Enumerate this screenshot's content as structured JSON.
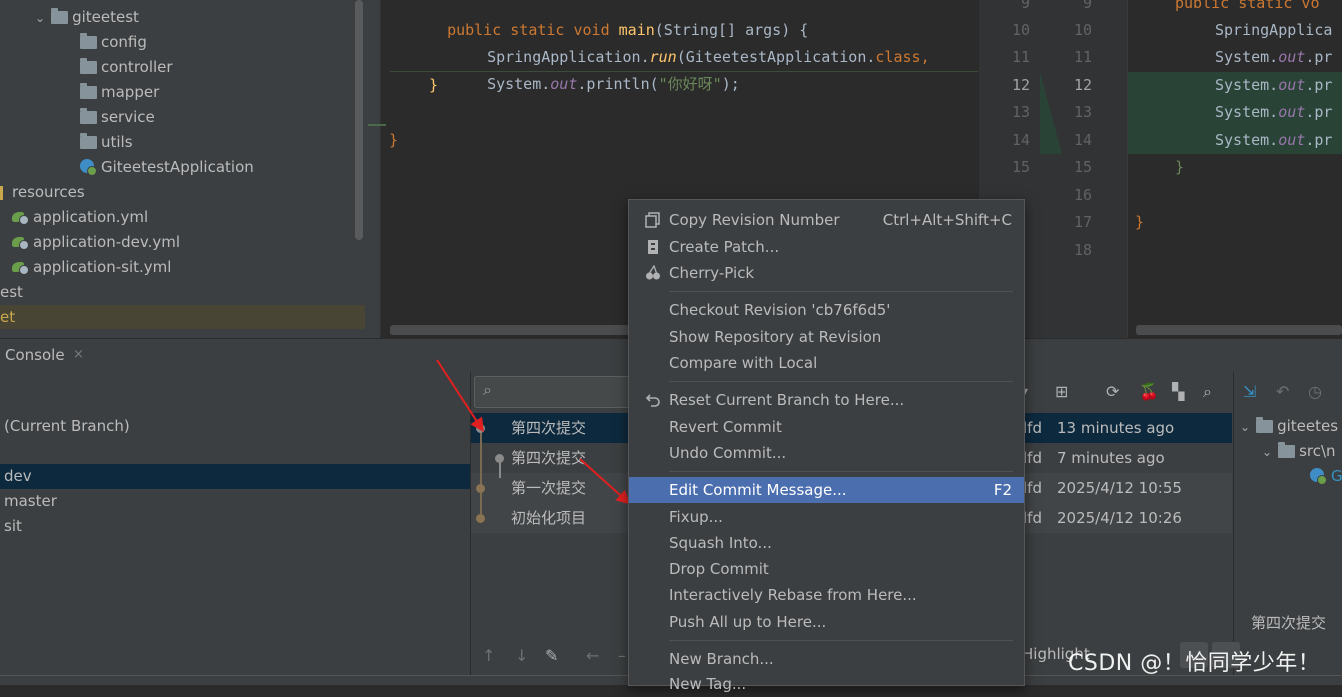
{
  "project_tree": {
    "items": [
      {
        "label": "giteetest",
        "type": "package"
      },
      {
        "label": "config",
        "type": "package"
      },
      {
        "label": "controller",
        "type": "package"
      },
      {
        "label": "mapper",
        "type": "package"
      },
      {
        "label": "service",
        "type": "package"
      },
      {
        "label": "utils",
        "type": "package"
      },
      {
        "label": "GiteetestApplication",
        "type": "class"
      },
      {
        "label": "resources",
        "type": "resources"
      },
      {
        "label": "application.yml",
        "type": "spring-yml"
      },
      {
        "label": "application-dev.yml",
        "type": "spring-yml"
      },
      {
        "label": "application-sit.yml",
        "type": "spring-yml"
      },
      {
        "label": "est",
        "type": "folder-partial"
      },
      {
        "label": "et",
        "type": "selected-partial"
      }
    ]
  },
  "editor": {
    "line1": {
      "kw": "public static void ",
      "fn": "main",
      "rest": "(String[] args) {"
    },
    "line2": {
      "a": "SpringApplication.",
      "b": "run",
      "c": "(GiteetestApplication.",
      "d": "class",
      "e": ","
    },
    "line3": {
      "a": "System.",
      "b": "out",
      "c": ".println(",
      "d": "\"你好呀\"",
      "e": ");"
    },
    "line4": "}",
    "line5": "}"
  },
  "diff": {
    "left_numbers": [
      "9",
      "10",
      "11",
      "12",
      "13",
      "14",
      "15"
    ],
    "right_numbers": [
      "9",
      "10",
      "11",
      "12",
      "13",
      "14",
      "15",
      "16",
      "17",
      "18"
    ],
    "code_top": {
      "kw": "public static vo"
    },
    "code_lines": [
      {
        "a": "SpringApplica",
        "b": ""
      },
      {
        "a": "System.",
        "b": "out",
        "c": ".pr"
      },
      {
        "a": "System.",
        "b": "out",
        "c": ".pr"
      },
      {
        "a": "System.",
        "b": "out",
        "c": ".pr"
      },
      {
        "a": "System.",
        "b": "out",
        "c": ".pr"
      }
    ],
    "brace1": "}",
    "brace2": "}"
  },
  "tool_window": {
    "console_tab": "Console",
    "close_glyph": "×"
  },
  "branches": {
    "current": "(Current Branch)",
    "items": [
      "dev",
      "master",
      "sit"
    ]
  },
  "log": {
    "search_icon": "search-icon",
    "commits": [
      {
        "message": "第四次提交",
        "hash": "lfd",
        "date": "13 minutes ago"
      },
      {
        "message": "第四次提交",
        "hash": "lfd",
        "date": "7 minutes ago"
      },
      {
        "message": "第一次提交",
        "hash": "lfd",
        "date": "2025/4/12 10:55"
      },
      {
        "message": "初始化项目",
        "hash": "lfd",
        "date": "2025/4/12 10:26"
      }
    ],
    "toolbar_icons": {
      "dropdown": "▾",
      "add": "⊞",
      "refresh": "⟳",
      "cherry": "🍒",
      "graph": "▚",
      "search": "⌕"
    },
    "bottom_icons": {
      "up": "↑",
      "down": "↓",
      "edit": "✎",
      "back": "←",
      "dash": "–"
    }
  },
  "changes": {
    "root": "giteetes",
    "src": "src\\n",
    "file_initial": "G",
    "subject": "第四次提交"
  },
  "bottom_bar": {
    "highlight": "Highlight",
    "watermark": "CSDN @！恰同学少年！"
  },
  "context_menu": {
    "groups": [
      [
        {
          "label": "Copy Revision Number",
          "shortcut": "Ctrl+Alt+Shift+C",
          "icon": "copy-icon"
        },
        {
          "label": "Create Patch...",
          "shortcut": "",
          "icon": "patch-icon"
        },
        {
          "label": "Cherry-Pick",
          "shortcut": "",
          "icon": "cherry-pick-icon"
        }
      ],
      [
        {
          "label": "Checkout Revision 'cb76f6d5'",
          "shortcut": ""
        },
        {
          "label": "Show Repository at Revision",
          "shortcut": ""
        },
        {
          "label": "Compare with Local",
          "shortcut": ""
        }
      ],
      [
        {
          "label": "Reset Current Branch to Here...",
          "shortcut": "",
          "icon": "undo-icon"
        },
        {
          "label": "Revert Commit",
          "shortcut": ""
        },
        {
          "label": "Undo Commit...",
          "shortcut": ""
        }
      ],
      [
        {
          "label": "Edit Commit Message...",
          "shortcut": "F2",
          "highlighted": true
        },
        {
          "label": "Fixup...",
          "shortcut": ""
        },
        {
          "label": "Squash Into...",
          "shortcut": ""
        },
        {
          "label": "Drop Commit",
          "shortcut": ""
        },
        {
          "label": "Interactively Rebase from Here...",
          "shortcut": ""
        },
        {
          "label": "Push All up to Here...",
          "shortcut": ""
        }
      ],
      [
        {
          "label": "New Branch...",
          "shortcut": ""
        },
        {
          "label": "New Tag...",
          "shortcut": ""
        }
      ]
    ]
  },
  "colors": {
    "accent": "#4b6eaf",
    "arrow": "#e02020",
    "selection": "#0d293e"
  }
}
